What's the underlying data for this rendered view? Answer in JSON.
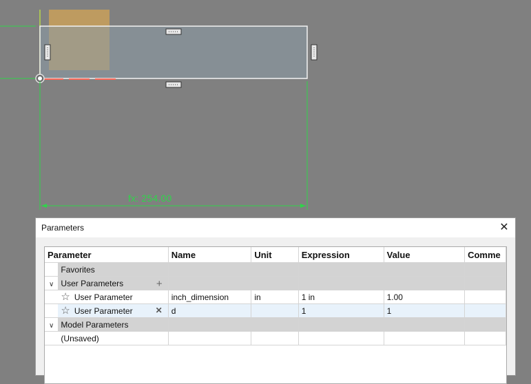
{
  "viewport": {
    "dimension_text": "fx: 254.00"
  },
  "dialog": {
    "title": "Parameters",
    "close_icon": "close-icon",
    "columns": [
      "Parameter",
      "Name",
      "Unit",
      "Expression",
      "Value",
      "Comme"
    ],
    "groups": {
      "favorites": "Favorites",
      "user_parameters": "User Parameters",
      "model_parameters": "Model Parameters"
    },
    "user_rows": [
      {
        "parameter": "User Parameter",
        "name": "inch_dimension",
        "unit": "in",
        "expression": "1 in",
        "value": "1.00",
        "comment": ""
      },
      {
        "parameter": "User Parameter",
        "name": "d",
        "unit": "",
        "expression": "1",
        "value": "1",
        "comment": ""
      }
    ],
    "model_rows": [
      {
        "parameter": "(Unsaved)"
      }
    ]
  },
  "colors": {
    "viewport_bg": "#808080",
    "dimension_green": "#2fd44a",
    "selection_highlight": "#e8f2fb",
    "group_row_bg": "#d3d3d3"
  }
}
